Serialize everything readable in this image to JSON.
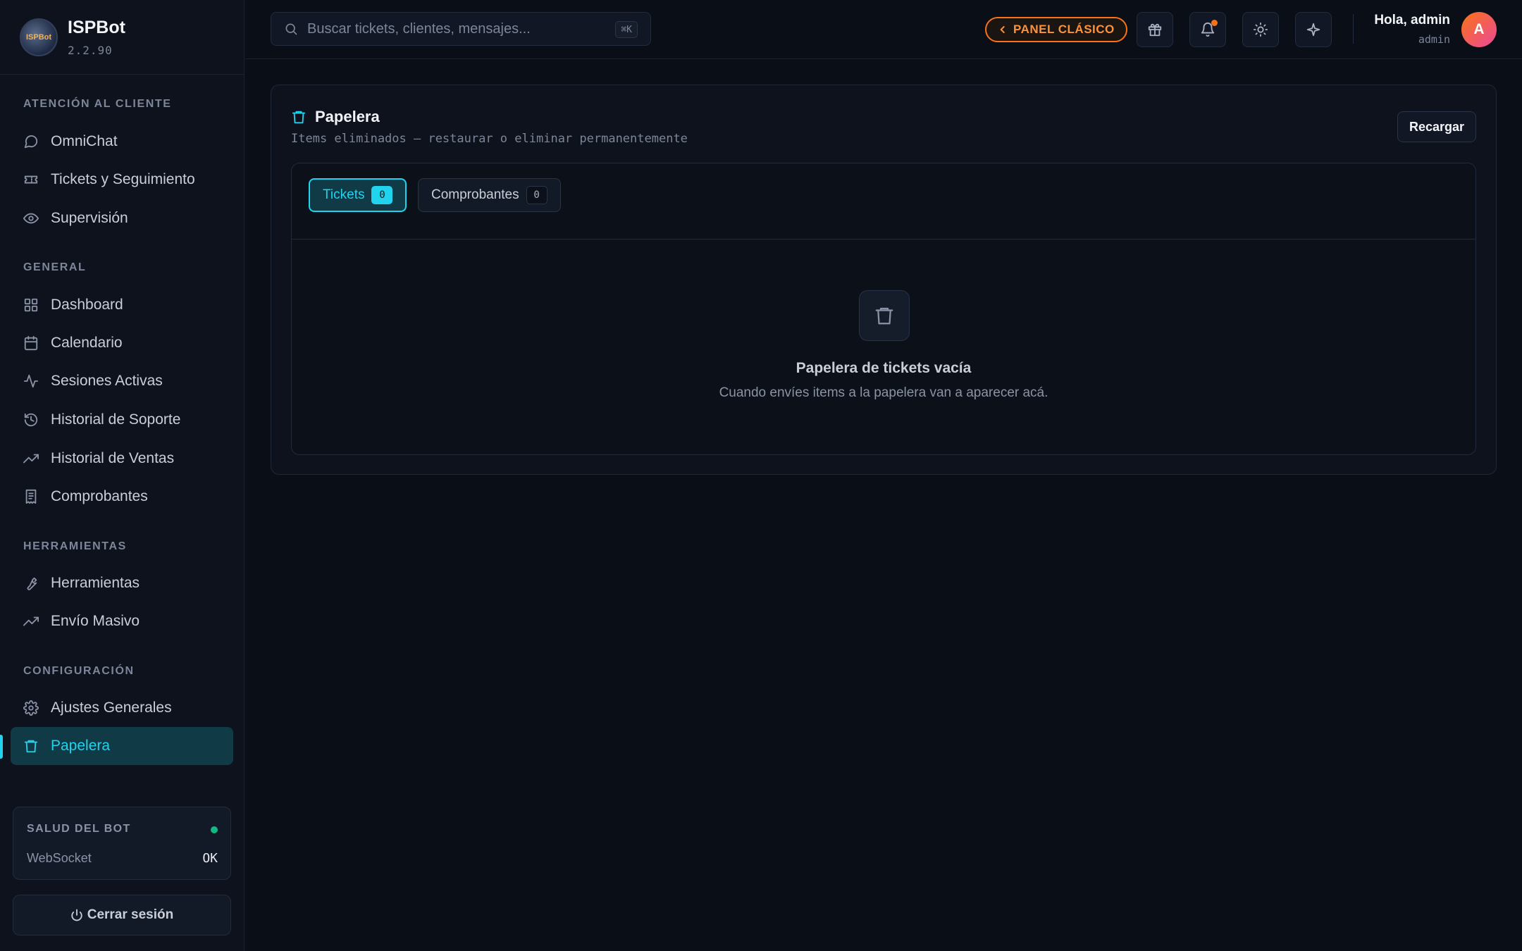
{
  "brand": {
    "name": "ISPBot",
    "version": "2.2.90",
    "logo_text": "ISPBot"
  },
  "sidebar": {
    "sections": [
      {
        "title": "ATENCIÓN AL CLIENTE"
      },
      {
        "title": "GENERAL"
      },
      {
        "title": "HERRAMIENTAS"
      },
      {
        "title": "CONFIGURACIÓN"
      }
    ],
    "items": [
      {
        "label": "OmniChat",
        "icon": "chat-bubble-icon"
      },
      {
        "label": "Tickets y Seguimiento",
        "icon": "ticket-icon"
      },
      {
        "label": "Supervisión",
        "icon": "eye-icon"
      },
      {
        "label": "Dashboard",
        "icon": "grid-icon"
      },
      {
        "label": "Calendario",
        "icon": "calendar-icon"
      },
      {
        "label": "Sesiones Activas",
        "icon": "activity-icon"
      },
      {
        "label": "Historial de Soporte",
        "icon": "history-icon"
      },
      {
        "label": "Historial de Ventas",
        "icon": "trending-up-icon"
      },
      {
        "label": "Comprobantes",
        "icon": "receipt-icon"
      },
      {
        "label": "Herramientas",
        "icon": "wrench-icon"
      },
      {
        "label": "Envío Masivo",
        "icon": "trending-up-icon"
      },
      {
        "label": "Ajustes Generales",
        "icon": "gear-icon"
      },
      {
        "label": "Papelera",
        "icon": "trash-icon",
        "active": true
      }
    ],
    "health": {
      "title": "SALUD DEL BOT",
      "status_color": "#10b981",
      "label": "WebSocket",
      "value": "OK"
    },
    "logout_label": "Cerrar sesión"
  },
  "header": {
    "search_placeholder": "Buscar tickets, clientes, mensajes...",
    "search_shortcut": "⌘K",
    "classic_label": "PANEL CLÁSICO",
    "greeting": "Hola, admin",
    "role": "admin",
    "avatar_initial": "A"
  },
  "main": {
    "title": "Papelera",
    "subtitle": "Items eliminados — restaurar o eliminar permanentemente",
    "reload_label": "Recargar",
    "tabs": [
      {
        "label": "Tickets",
        "count": "0",
        "active": true
      },
      {
        "label": "Comprobantes",
        "count": "0",
        "active": false
      }
    ],
    "empty_title": "Papelera de tickets vacía",
    "empty_subtitle": "Cuando envíes items a la papelera van a aparecer acá."
  },
  "colors": {
    "accent": "#22d3ee",
    "warning": "#f97316",
    "background": "#0a0e17"
  }
}
